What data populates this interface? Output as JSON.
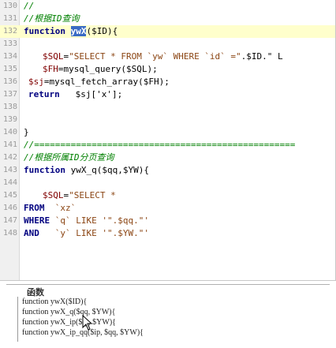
{
  "editor": {
    "lines": [
      {
        "num": "130",
        "text": "// "
      },
      {
        "num": "131",
        "text": "//根据ID查询"
      },
      {
        "num": "132",
        "text": ""
      },
      {
        "num": "133",
        "text": ""
      },
      {
        "num": "134",
        "text": ""
      },
      {
        "num": "135",
        "text": ""
      },
      {
        "num": "136",
        "text": ""
      },
      {
        "num": "137",
        "text": ""
      },
      {
        "num": "138",
        "text": ""
      },
      {
        "num": "139",
        "text": ""
      },
      {
        "num": "140",
        "text": "}"
      },
      {
        "num": "141",
        "text": "//=================================================="
      },
      {
        "num": "142",
        "text": "//根据所属ID分页查询"
      },
      {
        "num": "143",
        "text": ""
      },
      {
        "num": "144",
        "text": ""
      },
      {
        "num": "145",
        "text": ""
      },
      {
        "num": "146",
        "text": ""
      },
      {
        "num": "147",
        "text": ""
      },
      {
        "num": "148",
        "text": ""
      }
    ],
    "line132": {
      "kw": "function",
      "sel": "ywX",
      "rest": "($ID){"
    },
    "line134": {
      "var": "$SQL",
      "eq": "=",
      "str": "\"SELECT * FROM `yw` WHERE `id` =\"",
      "rest": ".$ID.\" L"
    },
    "line135": {
      "var": "$FH",
      "rest": "=mysql_query($SQL);"
    },
    "line136": {
      "var": "$sj",
      "rest": "=mysql_fetch_array($FH);"
    },
    "line137": {
      "kw": "return",
      "rest": "$sj['x'];"
    },
    "line143": {
      "kw": "function",
      "rest": "ywX_q($qq,$YW){"
    },
    "line145": {
      "var": "$SQL",
      "eq": "=",
      "str": "\"SELECT *"
    },
    "line146": {
      "kw": "FROM",
      "str": "`xz`"
    },
    "line147": {
      "kw": "WHERE",
      "str": "`q` LIKE '\".$qq.\"'"
    },
    "line148": {
      "kw": "AND",
      "str": "`y` LIKE '\".$YW.\"'"
    }
  },
  "nav": {
    "title": "函数",
    "items": [
      "function ywX($ID){",
      "function ywX_q($qq, $YW){",
      "function ywX_ip($ip, $YW){",
      "function ywX_ip_qq($ip, $qq, $YW){"
    ]
  }
}
